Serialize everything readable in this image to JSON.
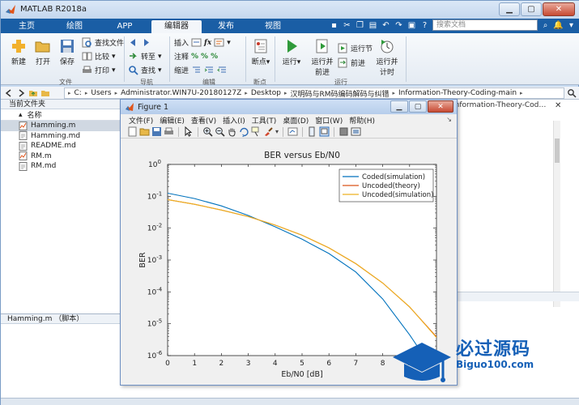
{
  "window": {
    "title": "MATLAB R2018a"
  },
  "tabs": [
    "主页",
    "绘图",
    "APP",
    "编辑器",
    "发布",
    "视图"
  ],
  "active_tab": "编辑器",
  "search": {
    "placeholder": "搜索文档"
  },
  "ribbon": {
    "file_group": {
      "label": "文件",
      "new": "新建",
      "open": "打开",
      "save": "保存",
      "find_files": "查找文件",
      "compare": "比较",
      "print": "打印"
    },
    "nav_group": {
      "label": "导航",
      "goto": "转至",
      "find": "查找"
    },
    "edit_group": {
      "label": "编辑",
      "insert": "插入",
      "comment": "注释",
      "indent": "缩进"
    },
    "breakpoint_group": {
      "label": "断点",
      "breakpoints": "断点"
    },
    "run_group": {
      "label": "运行",
      "run": "运行",
      "run_advance_l1": "运行并",
      "run_advance_l2": "前进",
      "run_section": "运行节",
      "advance": "前进",
      "run_time_l1": "运行并",
      "run_time_l2": "计时"
    }
  },
  "address": {
    "crumbs": [
      "C:",
      "Users",
      "Administrator.WIN7U-20180127Z",
      "Desktop",
      "汉明码与RM码编码解码与纠错",
      "Information-Theory-Coding-main"
    ]
  },
  "current_folder": {
    "title": "当前文件夹",
    "column": "名称",
    "files": [
      {
        "name": "Hamming.m",
        "type": "m",
        "selected": true
      },
      {
        "name": "Hamming.md",
        "type": "md",
        "selected": false
      },
      {
        "name": "README.md",
        "type": "md",
        "selected": false
      },
      {
        "name": "RM.m",
        "type": "m",
        "selected": false
      },
      {
        "name": "RM.md",
        "type": "md",
        "selected": false
      }
    ]
  },
  "details_panel": {
    "title": "Hamming.m （脚本）"
  },
  "right_panel": {
    "title": "Information-Theory-Cod…"
  },
  "figure": {
    "title": "Figure 1",
    "menu": [
      "文件(F)",
      "编辑(E)",
      "查看(V)",
      "插入(I)",
      "工具(T)",
      "桌面(D)",
      "窗口(W)",
      "帮助(H)"
    ]
  },
  "chart_data": {
    "type": "line",
    "title": "BER versus Eb/N0",
    "xlabel": "Eb/N0 [dB]",
    "ylabel": "BER",
    "xlim": [
      0,
      10
    ],
    "ylim": [
      1e-06,
      1
    ],
    "yscale": "log",
    "xticks": [
      0,
      1,
      2,
      3,
      4,
      5,
      6,
      7,
      8,
      9
    ],
    "yticks": [
      "10^0",
      "10^-1",
      "10^-2",
      "10^-3",
      "10^-4",
      "10^-5",
      "10^-6"
    ],
    "legend_position": "top-right",
    "grid": false,
    "series": [
      {
        "name": "Coded(simulation)",
        "color": "#0072BD",
        "x": [
          0,
          1,
          2,
          3,
          4,
          5,
          6,
          7,
          8,
          9,
          9.7
        ],
        "y": [
          0.125,
          0.085,
          0.05,
          0.025,
          0.011,
          0.0045,
          0.0016,
          0.00042,
          6e-05,
          4.5e-06,
          6e-07
        ]
      },
      {
        "name": "Uncoded(theory)",
        "color": "#D95319",
        "x": [
          0,
          1,
          2,
          3,
          4,
          5,
          6,
          7,
          8,
          9,
          10
        ],
        "y": [
          0.079,
          0.056,
          0.037,
          0.023,
          0.0125,
          0.006,
          0.0024,
          0.00077,
          0.00019,
          3.36e-05,
          3.9e-06
        ]
      },
      {
        "name": "Uncoded(simulation)",
        "color": "#EDB120",
        "x": [
          0,
          1,
          2,
          3,
          4,
          5,
          6,
          7,
          8,
          9,
          10
        ],
        "y": [
          0.079,
          0.056,
          0.037,
          0.023,
          0.0125,
          0.006,
          0.0024,
          0.00077,
          0.00019,
          3.4e-05,
          3.7e-06
        ]
      }
    ]
  },
  "watermark": {
    "line1": "必过源码",
    "line2": "Biguo100.com"
  }
}
